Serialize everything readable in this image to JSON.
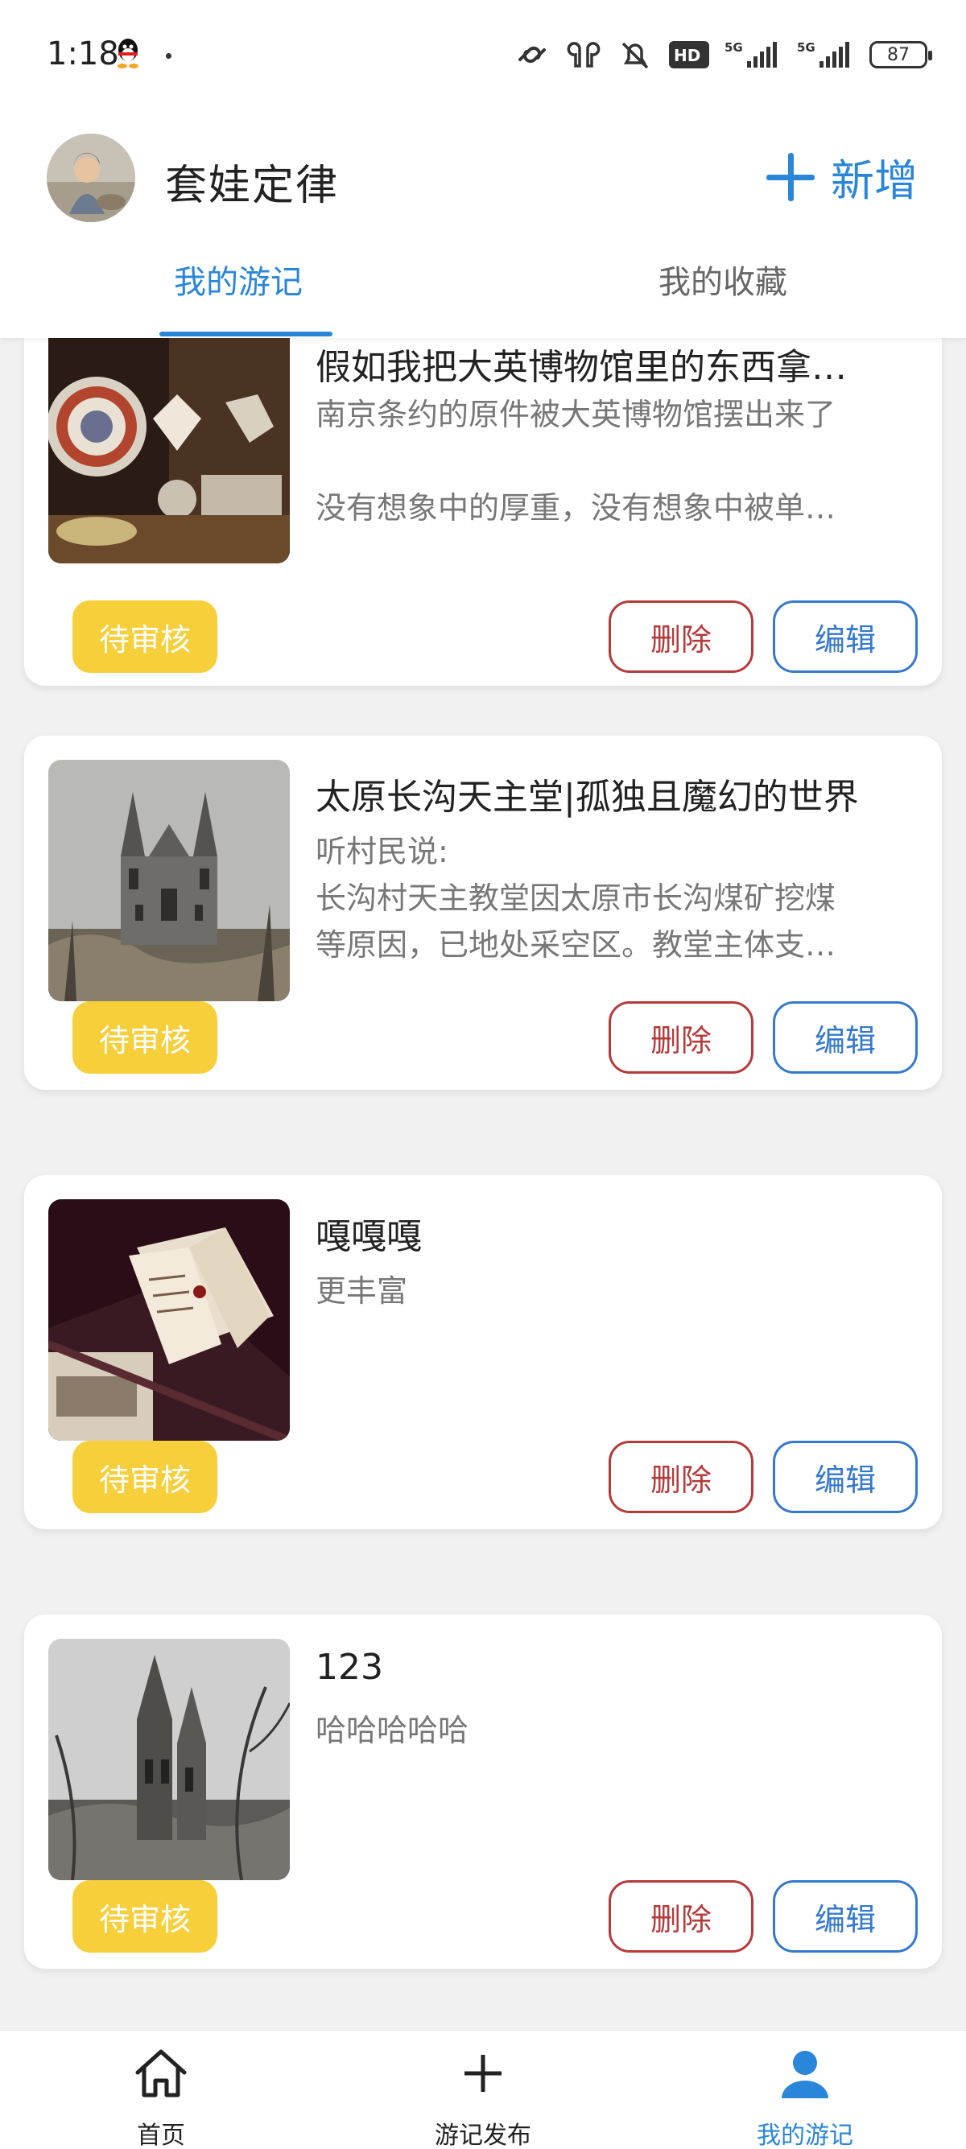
{
  "status_bar": {
    "time": "1:18",
    "battery": "87"
  },
  "header": {
    "username": "套娃定律",
    "add_label": "新增",
    "tabs": [
      {
        "label": "我的游记",
        "active": true
      },
      {
        "label": "我的收藏",
        "active": false
      }
    ]
  },
  "cards": [
    {
      "title": "假如我把大英博物馆里的东西拿…",
      "desc_lines": [
        "南京条约的原件被大英博物馆摆出来了",
        "",
        "没有想象中的厚重，没有想象中被单…"
      ],
      "status": "待审核",
      "delete_label": "删除",
      "edit_label": "编辑"
    },
    {
      "title": "太原长沟天主堂|孤独且魔幻的世界",
      "desc_lines": [
        "听村民说:",
        "长沟村天主教堂因太原市长沟煤矿挖煤",
        "等原因，已地处采空区。教堂主体支…"
      ],
      "status": "待审核",
      "delete_label": "删除",
      "edit_label": "编辑"
    },
    {
      "title": "嘎嘎嘎",
      "desc_lines": [
        "更丰富"
      ],
      "status": "待审核",
      "delete_label": "删除",
      "edit_label": "编辑"
    },
    {
      "title": "123",
      "desc_lines": [
        "哈哈哈哈哈"
      ],
      "status": "待审核",
      "delete_label": "删除",
      "edit_label": "编辑"
    }
  ],
  "bottom_nav": [
    {
      "label": "首页",
      "icon": "home-icon",
      "active": false
    },
    {
      "label": "游记发布",
      "icon": "plus-icon",
      "active": false
    },
    {
      "label": "我的游记",
      "icon": "user-icon",
      "active": true
    }
  ],
  "colors": {
    "accent": "#2a86d8",
    "pending": "#f7cf3a",
    "delete": "#b63a3a",
    "edit": "#3579cc"
  }
}
